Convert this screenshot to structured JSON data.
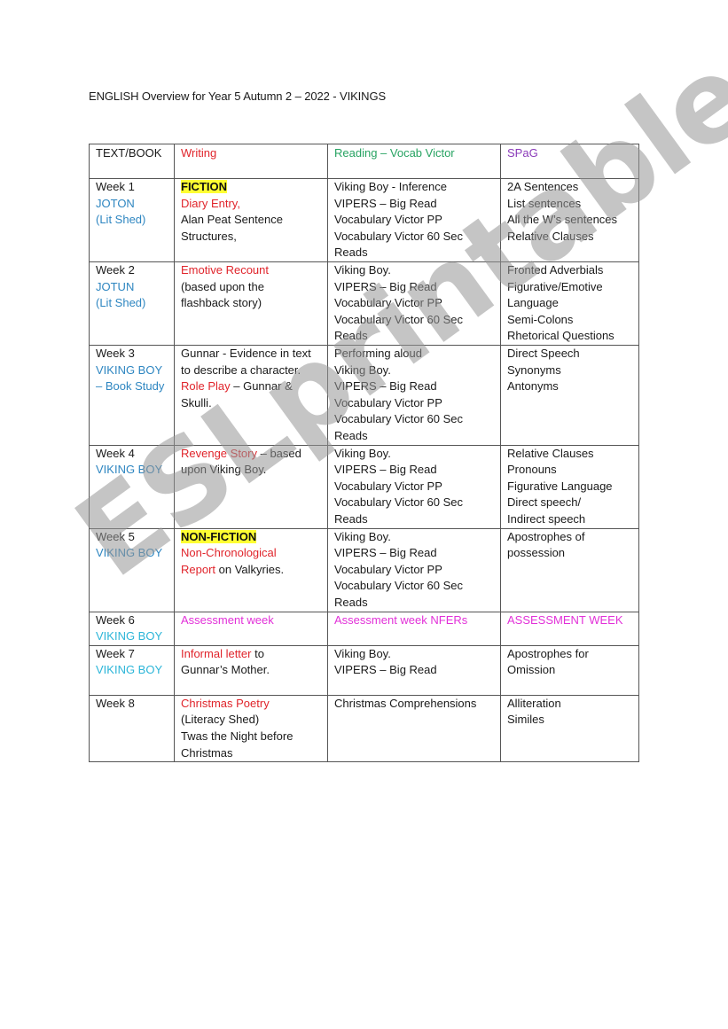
{
  "document": {
    "title": "ENGLISH Overview for Year 5 Autumn 2 – 2022 - VIKINGS",
    "watermark": "ESLprintables.com"
  },
  "colors": {
    "writing_red": "#e0242b",
    "book_blue": "#2e86c1",
    "book_cyan": "#2bb5d8",
    "reading_green": "#27a362",
    "spag_purple": "#8a3ab9",
    "assessment_magenta": "#e230d8",
    "highlight_yellow": "#ffff33"
  },
  "table": {
    "headers": {
      "text_book": "TEXT/BOOK",
      "writing": "Writing",
      "reading": "Reading – Vocab Victor",
      "spag": "SPaG"
    },
    "rows": [
      {
        "week": "Week 1",
        "book": [
          "JOTON",
          "(Lit Shed)"
        ],
        "writing": {
          "highlight": "FICTION",
          "red": "Diary Entry,",
          "lines": [
            "Alan Peat Sentence",
            "Structures,"
          ]
        },
        "reading": [
          "Viking Boy - Inference",
          "VIPERS – Big Read",
          "Vocabulary Victor PP",
          "Vocabulary Victor 60 Sec",
          "Reads"
        ],
        "spag": [
          "2A Sentences",
          "List sentences",
          "All the W’s sentences",
          "Relative Clauses"
        ]
      },
      {
        "week": "Week 2",
        "book": [
          "JOTUN",
          "(Lit Shed)"
        ],
        "writing": {
          "red": "Emotive Recount",
          "lines": [
            "(based upon the",
            "flashback story)"
          ]
        },
        "reading": [
          "Viking Boy.",
          "VIPERS – Big Read",
          "Vocabulary Victor PP",
          "Vocabulary Victor 60 Sec",
          "Reads"
        ],
        "spag": [
          "Fronted Adverbials",
          "Figurative/Emotive",
          "Language",
          "Semi-Colons",
          "Rhetorical Questions"
        ]
      },
      {
        "week": "Week 3",
        "book": [
          "VIKING BOY",
          "– Book Study"
        ],
        "writing": {
          "lines": [
            "Gunnar - Evidence in text",
            "to describe a character."
          ],
          "red": "Role Play",
          "after_red": " – Gunnar &",
          "tail": "Skulli."
        },
        "reading": [
          "Performing aloud",
          "Viking Boy.",
          "VIPERS – Big Read",
          "Vocabulary Victor PP",
          "Vocabulary Victor 60 Sec",
          "Reads"
        ],
        "spag": [
          "Direct Speech",
          "Synonyms",
          "Antonyms"
        ]
      },
      {
        "week": "Week 4",
        "book": [
          "VIKING BOY"
        ],
        "writing": {
          "red": "Revenge Story",
          "after_red": " – based",
          "tail": "upon Viking Boy."
        },
        "reading": [
          "Viking Boy.",
          "VIPERS – Big Read",
          "Vocabulary Victor PP",
          "Vocabulary Victor 60 Sec",
          "Reads"
        ],
        "spag": [
          "Relative Clauses",
          "Pronouns",
          "Figurative Language",
          "Direct speech/",
          "Indirect speech"
        ]
      },
      {
        "week": "Week 5",
        "book": [
          "VIKING BOY"
        ],
        "writing": {
          "highlight": "NON-FICTION",
          "red": "Non-Chronological",
          "red2": "Report",
          "after_red2": " on Valkyries."
        },
        "reading": [
          "Viking Boy.",
          "VIPERS – Big Read",
          "Vocabulary Victor PP",
          "Vocabulary Victor 60 Sec",
          "Reads"
        ],
        "spag": [
          "Apostrophes of",
          "possession"
        ]
      },
      {
        "week": "Week 6",
        "book": [
          "VIKING BOY"
        ],
        "writing": {
          "magenta": "Assessment week"
        },
        "reading_magenta": "Assessment week NFERs",
        "spag_magenta": "ASSESSMENT WEEK"
      },
      {
        "week": "Week 7",
        "book": [
          "VIKING BOY"
        ],
        "writing": {
          "red": "Informal letter",
          "after_red": " to",
          "tail": "Gunnar’s Mother."
        },
        "reading": [
          "Viking Boy.",
          "VIPERS – Big Read"
        ],
        "spag": [
          "Apostrophes for",
          "Omission"
        ]
      },
      {
        "week": "Week 8",
        "book": [],
        "writing": {
          "red": "Christmas Poetry",
          "lines": [
            "(Literacy Shed)",
            "Twas the Night before",
            "Christmas"
          ]
        },
        "reading": [
          "Christmas Comprehensions"
        ],
        "spag": [
          "Alliteration",
          "Similes"
        ]
      }
    ]
  }
}
